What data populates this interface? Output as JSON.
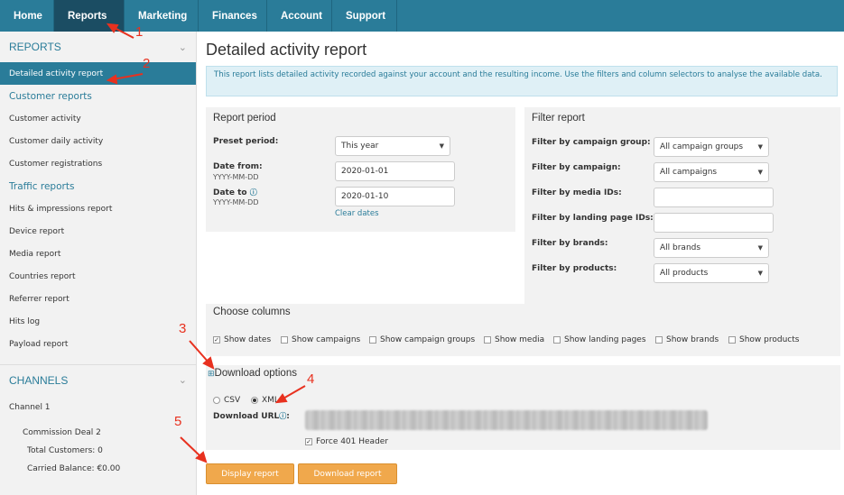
{
  "nav": {
    "tabs": [
      "Home",
      "Reports",
      "Marketing",
      "Finances",
      "Account",
      "Support"
    ]
  },
  "sidebar": {
    "reports_heading": "REPORTS",
    "active_item": "Detailed activity report",
    "customer_heading": "Customer reports",
    "customer_items": [
      "Customer activity",
      "Customer daily activity",
      "Customer registrations"
    ],
    "traffic_heading": "Traffic reports",
    "traffic_items": [
      "Hits & impressions report",
      "Device report",
      "Media report",
      "Countries report",
      "Referrer report",
      "Hits log",
      "Payload report"
    ],
    "channels_heading": "CHANNELS",
    "channel_name": "Channel 1",
    "deal_name": "Commission Deal 2",
    "total_customers": "Total Customers: 0",
    "carried_balance": "Carried Balance: €0.00"
  },
  "page": {
    "title": "Detailed activity report",
    "info": "This report lists detailed activity recorded against your account and the resulting income. Use the filters and column selectors to analyse the available data."
  },
  "period": {
    "title": "Report period",
    "preset_label": "Preset period:",
    "preset_value": "This year",
    "from_label": "Date from:",
    "from_hint": "YYYY-MM-DD",
    "from_value": "2020-01-01",
    "to_label": "Date to",
    "to_hint": "YYYY-MM-DD",
    "to_value": "2020-01-10",
    "clear": "Clear dates"
  },
  "filter": {
    "title": "Filter report",
    "group_label": "Filter by campaign group:",
    "group_value": "All campaign groups",
    "campaign_label": "Filter by campaign:",
    "campaign_value": "All campaigns",
    "media_label": "Filter by media IDs:",
    "landing_label": "Filter by landing page IDs:",
    "brands_label": "Filter by brands:",
    "brands_value": "All brands",
    "products_label": "Filter by products:",
    "products_value": "All products"
  },
  "columns": {
    "title": "Choose columns",
    "options": [
      "Show dates",
      "Show campaigns",
      "Show campaign groups",
      "Show media",
      "Show landing pages",
      "Show brands",
      "Show products"
    ]
  },
  "download": {
    "title": "Download options",
    "csv": "CSV",
    "xml": "XML",
    "url_label": "Download URL",
    "force_header": "Force 401 Header"
  },
  "buttons": {
    "display": "Display report",
    "download": "Download report"
  },
  "annotations": [
    "1",
    "2",
    "3",
    "4",
    "5"
  ],
  "colors": {
    "accent": "#2a7c99",
    "nav_active": "#1b4d63",
    "button": "#f0a84c",
    "annotation": "#e8311f"
  }
}
